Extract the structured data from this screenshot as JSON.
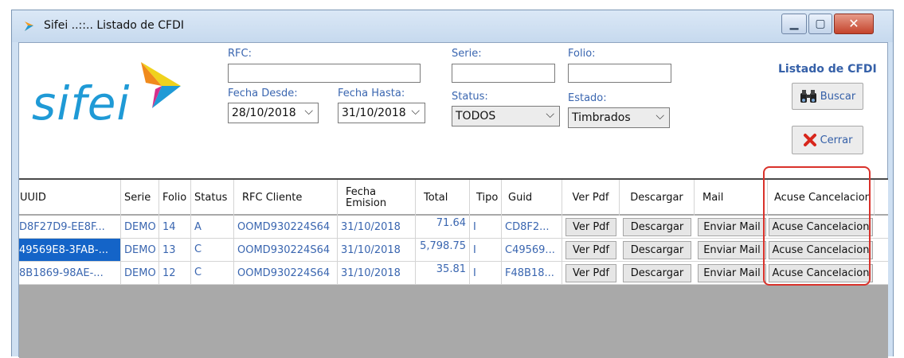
{
  "window": {
    "title": "Sifei ..::.. Listado de CFDI"
  },
  "logo": {
    "text": "sifei"
  },
  "filters": {
    "rfc_label": "RFC:",
    "rfc_value": "",
    "serie_label": "Serie:",
    "serie_value": "",
    "folio_label": "Folio:",
    "folio_value": "",
    "fecha_desde_label": "Fecha Desde:",
    "fecha_desde_value": "28/10/2018",
    "fecha_hasta_label": "Fecha Hasta:",
    "fecha_hasta_value": "31/10/2018",
    "status_label": "Status:",
    "status_value": "TODOS",
    "estado_label": "Estado:",
    "estado_value": "Timbrados"
  },
  "side": {
    "heading": "Listado de CFDI",
    "buscar_label": "Buscar",
    "cerrar_label": "Cerrar"
  },
  "grid": {
    "columns": {
      "uuid": "UUID",
      "serie": "Serie",
      "folio": "Folio",
      "status": "Status",
      "rfc_cliente": "RFC Cliente",
      "fecha_emision": "Fecha Emision",
      "total": "Total",
      "tipo": "Tipo",
      "guid": "Guid",
      "ver_pdf": "Ver Pdf",
      "descargar": "Descargar",
      "mail": "Mail",
      "acuse": "Acuse Cancelacion"
    },
    "rows": [
      {
        "uuid": "D8F27D9-EE8F...",
        "serie": "DEMO",
        "folio": "14",
        "status": "A",
        "rfc": "OOMD930224S64",
        "fecha": "31/10/2018",
        "total": "71.64",
        "tipo": "I",
        "guid": "CD8F2...",
        "ver_pdf": "Ver Pdf",
        "descargar": "Descargar",
        "mail": "Enviar Mail",
        "acuse": "Acuse Cancelacion"
      },
      {
        "uuid": "49569E8-3FAB-...",
        "serie": "DEMO",
        "folio": "13",
        "status": "C",
        "rfc": "OOMD930224S64",
        "fecha": "31/10/2018",
        "total": "5,798.75",
        "tipo": "I",
        "guid": "C49569...",
        "ver_pdf": "Ver Pdf",
        "descargar": "Descargar",
        "mail": "Enviar Mail",
        "acuse": "Acuse Cancelacion"
      },
      {
        "uuid": "8B1869-98AE-...",
        "serie": "DEMO",
        "folio": "12",
        "status": "C",
        "rfc": "OOMD930224S64",
        "fecha": "31/10/2018",
        "total": "35.81",
        "tipo": "I",
        "guid": "F48B18...",
        "ver_pdf": "Ver Pdf",
        "descargar": "Descargar",
        "mail": "Enviar Mail",
        "acuse": "Acuse Cancelacion"
      }
    ]
  },
  "colors": {
    "accent": "#3560a8",
    "selection": "#1464c8",
    "highlight": "#f4f23a",
    "annotation": "#d9322b"
  },
  "icons": [
    "arrow-logo-icon",
    "minimize-icon",
    "maximize-icon",
    "close-icon",
    "binoculars-icon",
    "red-x-icon",
    "chevron-down-icon"
  ]
}
